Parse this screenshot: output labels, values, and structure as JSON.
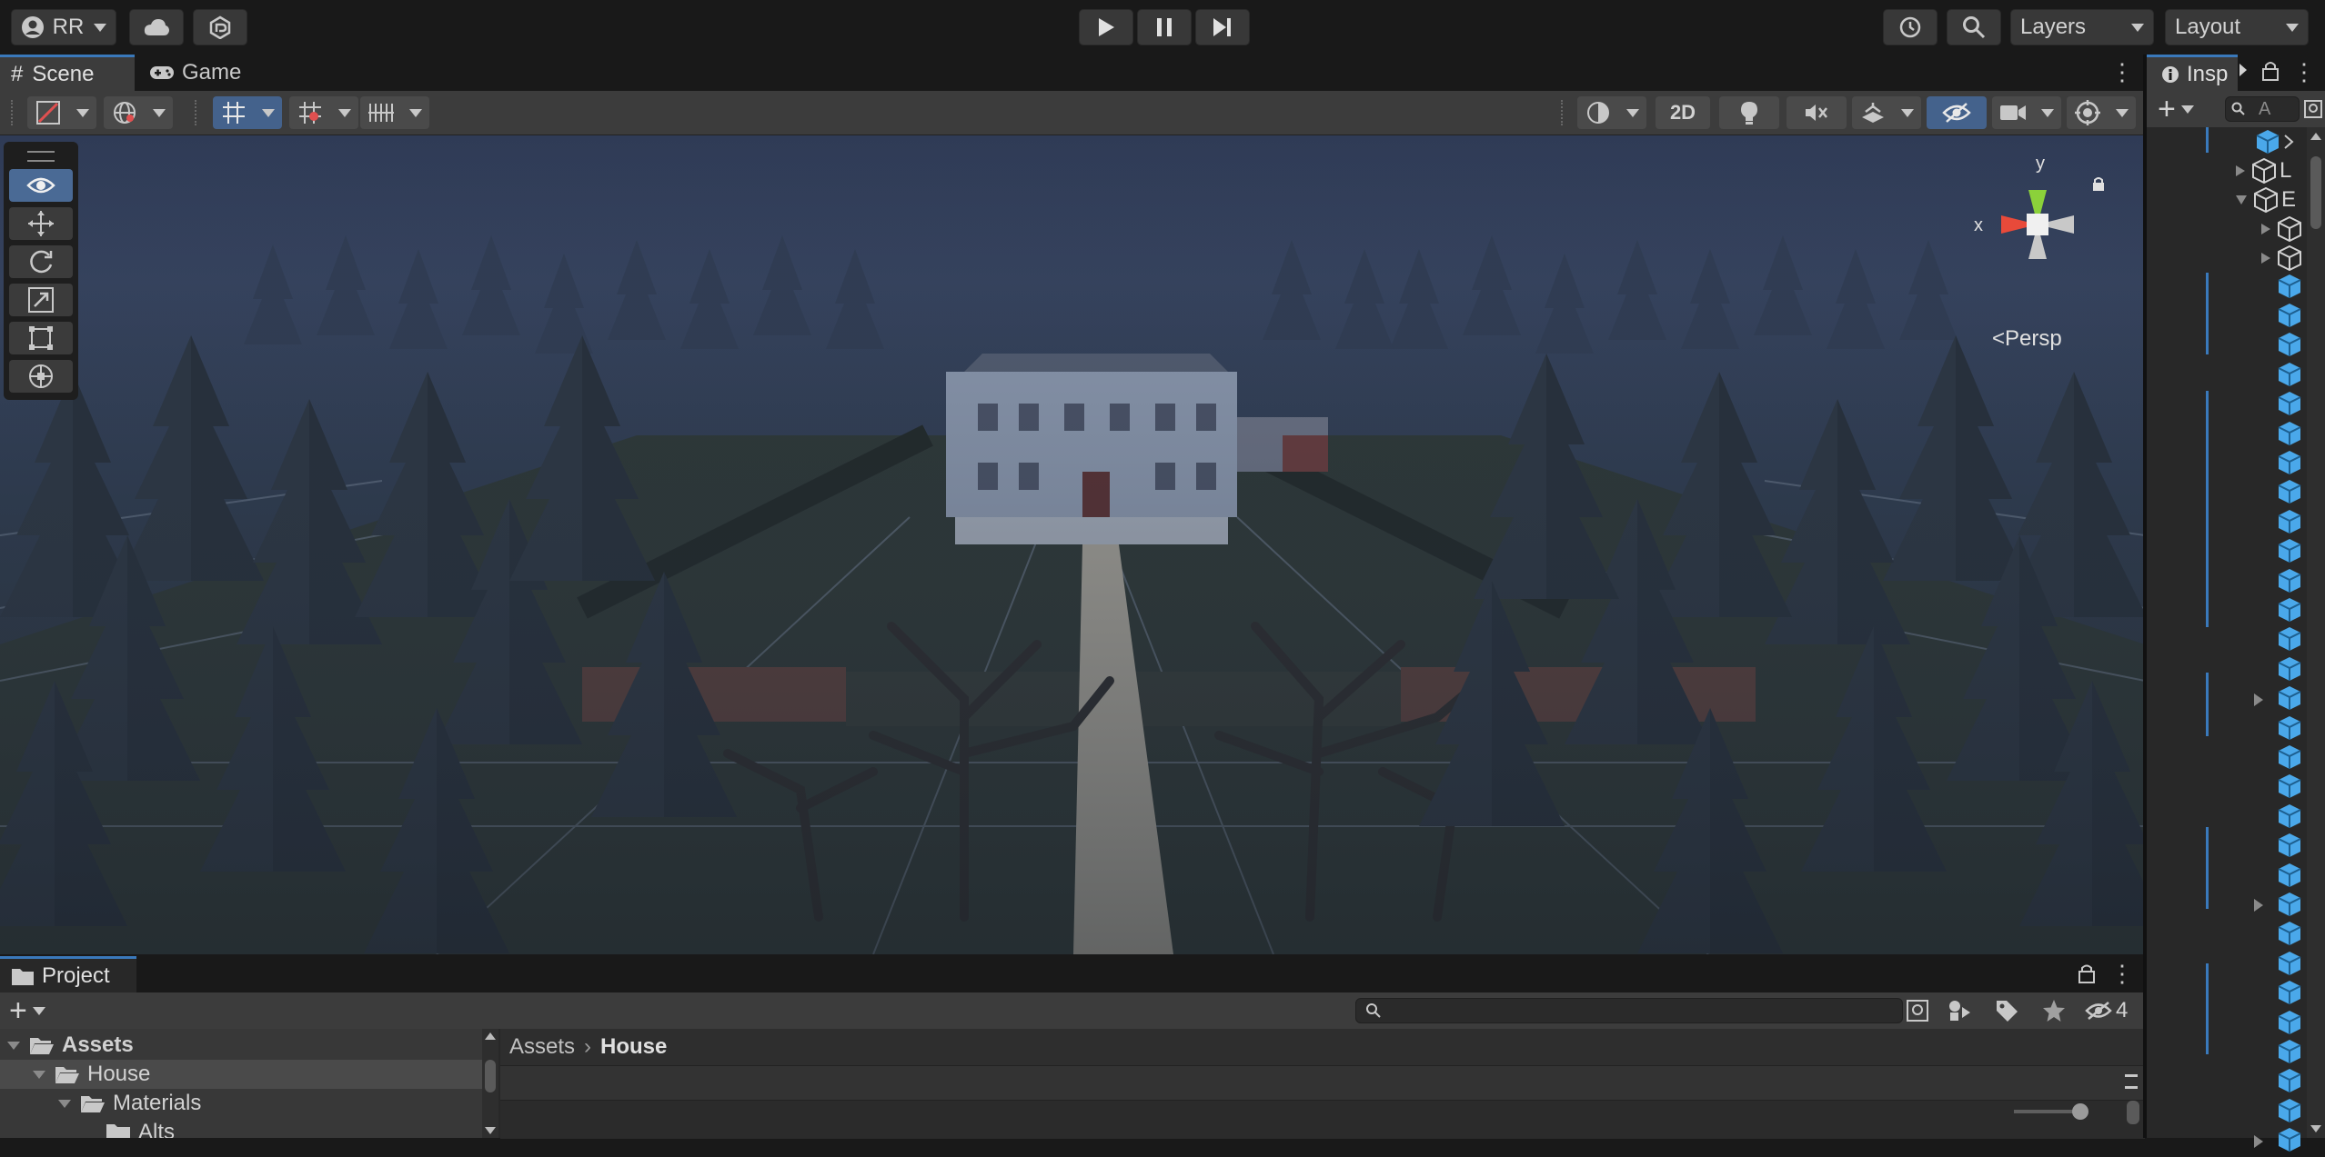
{
  "topbar": {
    "account_label": "RR",
    "layers_label": "Layers",
    "layout_label": "Layout"
  },
  "scene_tabs": {
    "scene_label": "Scene",
    "game_label": "Game"
  },
  "scene_toolbar": {
    "toggle_2d_label": "2D"
  },
  "gizmo": {
    "y_label": "y",
    "x_label": "x",
    "persp_label": "<Persp"
  },
  "hierarchy": {
    "tab_label": "Insp",
    "search_placeholder": "A",
    "rows": [
      "L",
      "E"
    ]
  },
  "project": {
    "tab_label": "Project",
    "hidden_count": "4",
    "tree": [
      "Assets",
      "House",
      "Materials",
      "Alts"
    ],
    "breadcrumb_root": "Assets",
    "breadcrumb_current": "House"
  },
  "colors": {
    "accent": "#3a79bb",
    "cube": "#4aa8ea",
    "toolbar_bg": "#3c3c3c",
    "panel_bg": "#282828"
  }
}
